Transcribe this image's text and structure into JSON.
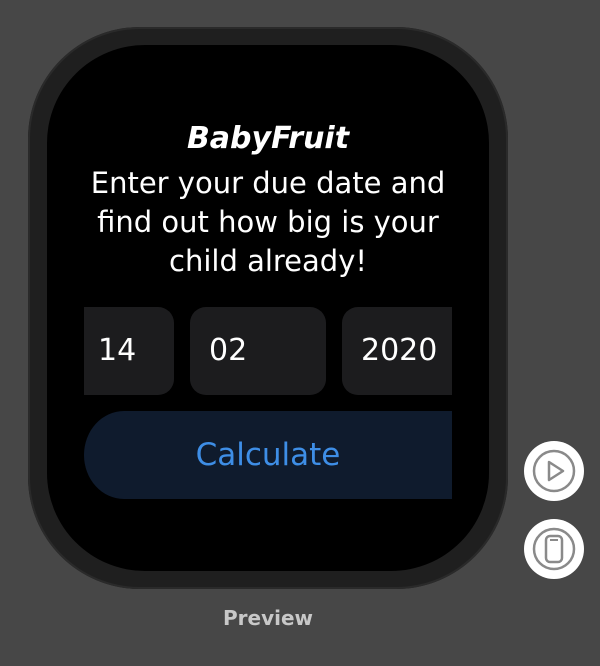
{
  "app": {
    "title": "BabyFruit",
    "description": "Enter your due date and find out how big is your child already!"
  },
  "date_picker": {
    "day": "14",
    "month": "02",
    "year": "2020"
  },
  "actions": {
    "calculate_label": "Calculate"
  },
  "canvas": {
    "preview_label": "Preview",
    "controls": [
      {
        "icon": "play-circle-icon"
      },
      {
        "icon": "device-icon"
      }
    ]
  },
  "colors": {
    "background": "#474747",
    "screen": "#000000",
    "field": "#1c1c1e",
    "button_bg": "#0f1b2d",
    "accent": "#3e8ee6"
  }
}
